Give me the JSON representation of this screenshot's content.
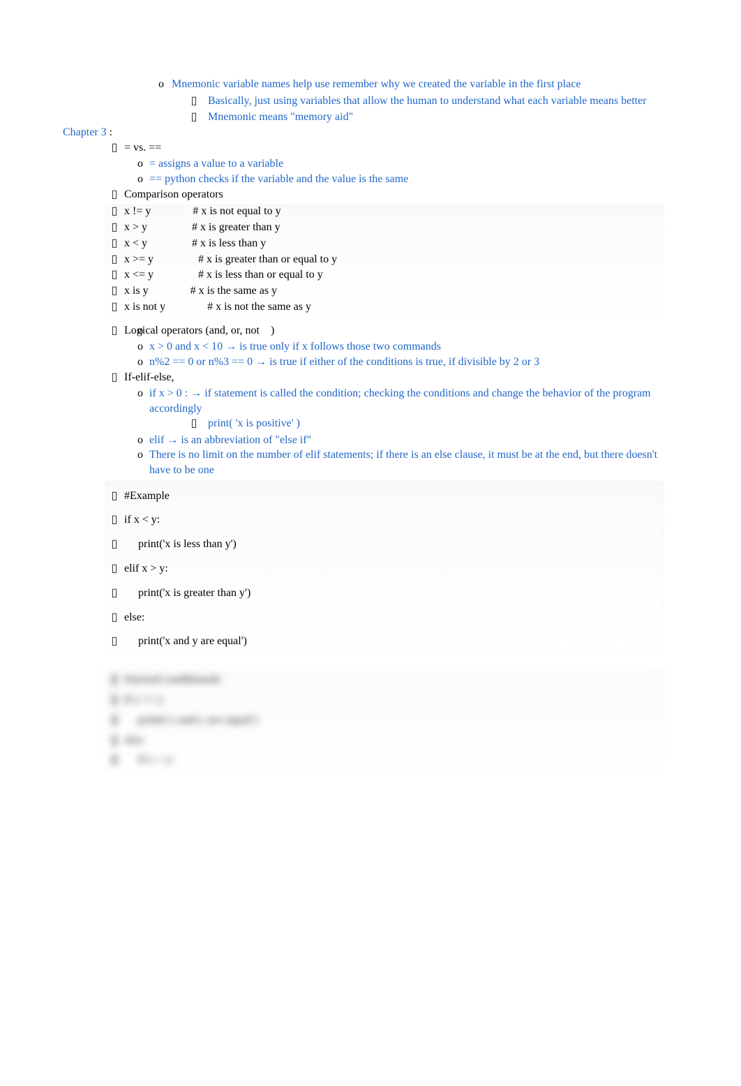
{
  "intro": {
    "mnemonic_line": "Mnemonic variable names help use remember why we created the variable in the first place",
    "basically": "Basically, just using variables that allow the human to understand what each variable means better",
    "meaning": "Mnemonic means \"memory aid\""
  },
  "chapter": "Chapter 3",
  "chapter_colon": "  :",
  "vs_header": "= vs. ==",
  "vs": {
    "assign": "= assigns a value to a variable",
    "equals": "== python checks if the variable and the value is the same"
  },
  "comparison": {
    "title": "Comparison operators",
    "rows": [
      "x != y               # x is not equal to y",
      "x > y                # x is greater than y",
      "x < y                # x is less than y",
      "x >= y                # x is greater than or equal to y",
      "x <= y                # x is less than or equal to y",
      "x is y               # x is the same as y",
      "x is not y               # x is not the same as y"
    ]
  },
  "logical": {
    "title_pre": "Logical operators (and, or, not",
    "title_post": ")",
    "line1": "x > 0 and x < 10  →  is true only if x follows those two commands",
    "line2": "n%2 == 0 or n%3 == 0  →  is true if either of the conditions is true, if divisible by 2 or 3"
  },
  "ifelif": {
    "title": "If-elif-else,",
    "line1_pre": "if x > 0 :       →  if statement is called the condition; checking the conditions and change the behavior of the program accordingly",
    "print_line": "print( 'x is positive' )",
    "line2": "elif  →  is an abbreviation of \"else if\"",
    "line3": "There is no limit on the number of elif statements; if there is an else clause, it must be at the end, but there doesn't have to be one"
  },
  "example": {
    "title": "#Example",
    "lines": [
      "if x < y:",
      "     print('x is less than y')",
      "elif x > y:",
      "     print('x is greater than y')",
      "else:",
      "     print('x and y are equal')"
    ]
  },
  "obscured": {
    "rows": [
      "#nested conditionals",
      "if x == y",
      "     print('x and y are equal')",
      "else:",
      "     if x < y:"
    ]
  }
}
